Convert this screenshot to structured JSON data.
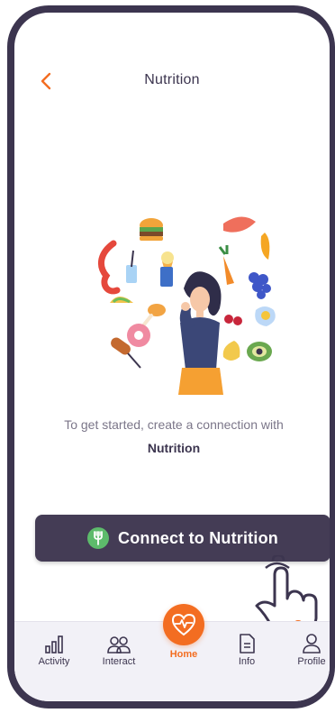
{
  "header": {
    "title": "Nutrition"
  },
  "intro": {
    "line": "To get started, create a connection with",
    "provider": "Nutrition"
  },
  "connect_button": {
    "label": "Connect to Nutrition"
  },
  "tap_hint": {
    "step": "2"
  },
  "tabbar": {
    "activity": "Activity",
    "interact": "Interact",
    "home": "Home",
    "info": "Info",
    "profile": "Profile"
  },
  "colors": {
    "accent": "#f36d21",
    "dark": "#443c55",
    "fork_badge": "#5dbb6b"
  },
  "icons": [
    "back-chevron-icon",
    "fork-icon",
    "tap-hand-icon",
    "activity-bars-icon",
    "people-icon",
    "heart-pulse-icon",
    "document-icon",
    "person-icon"
  ]
}
